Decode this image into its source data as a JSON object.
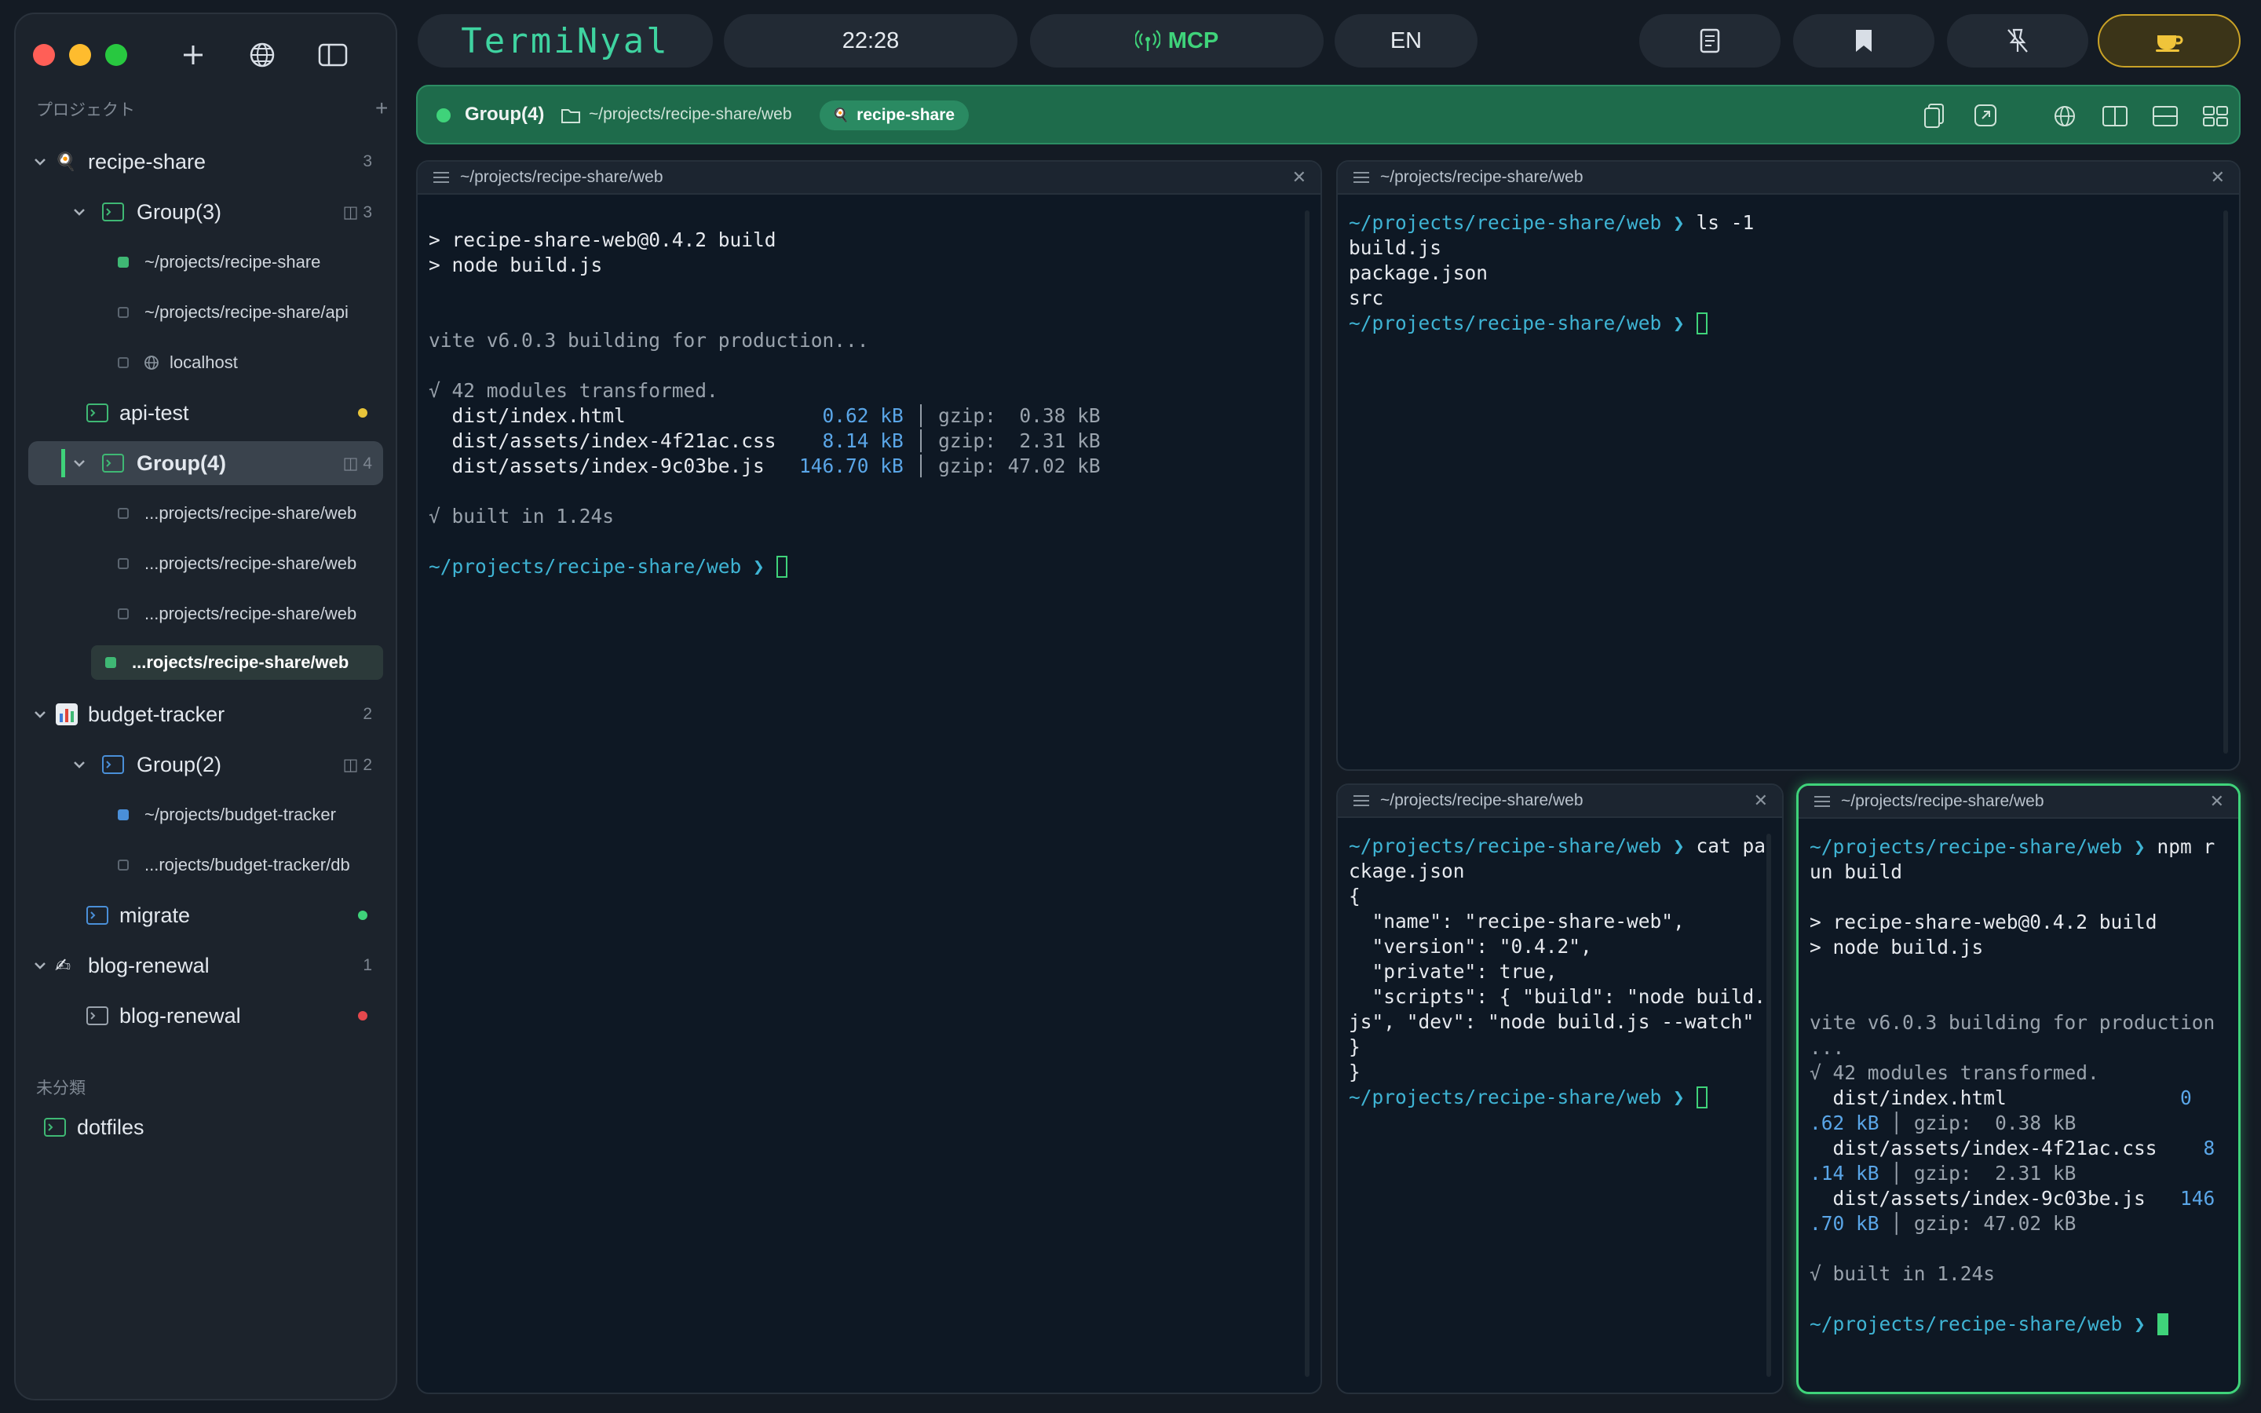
{
  "window": {
    "app_logo_text": "TermiNyal",
    "clock": "22:28",
    "mcp_label": "MCP",
    "lang_label": "EN"
  },
  "sidebar": {
    "projects_heading": "プロジェクト",
    "uncategorized_heading": "未分類",
    "projects": [
      {
        "name": "recipe-share",
        "count": "3",
        "group3": {
          "label": "Group(3)",
          "count": "3",
          "items": [
            "~/projects/recipe-share",
            "~/projects/recipe-share/api",
            "localhost"
          ]
        },
        "api_test": "api-test",
        "group4": {
          "label": "Group(4)",
          "count": "4",
          "items": [
            "...projects/recipe-share/web",
            "...projects/recipe-share/web",
            "...projects/recipe-share/web",
            "...rojects/recipe-share/web"
          ]
        }
      },
      {
        "name": "budget-tracker",
        "count": "2",
        "group2": {
          "label": "Group(2)",
          "count": "2",
          "items": [
            "~/projects/budget-tracker",
            "...rojects/budget-tracker/db"
          ]
        },
        "migrate": "migrate"
      },
      {
        "name": "blog-renewal",
        "count": "1",
        "item": "blog-renewal"
      }
    ],
    "dotfiles": "dotfiles"
  },
  "groupbar": {
    "label": "Group(4)",
    "path": "~/projects/recipe-share/web",
    "project_chip": "recipe-share"
  },
  "panes": {
    "header_path": "~/projects/recipe-share/web",
    "prompt": "~/projects/recipe-share/web ❯",
    "left": {
      "l1": "> recipe-share-web@0.4.2 build",
      "l2": "> node build.js",
      "l3": "vite v6.0.3 building for production...",
      "l4": "√ 42 modules transformed.",
      "f1": "dist/index.html",
      "s1": "0.62 kB",
      "z1": "gzip:  0.38 kB",
      "f2": "dist/assets/index-4f21ac.css",
      "s2": "8.14 kB",
      "z2": "gzip:  2.31 kB",
      "f3": "dist/assets/index-9c03be.js",
      "s3": "146.70 kB",
      "z3": "gzip: 47.02 kB",
      "l5": "√ built in 1.24s"
    },
    "top_right": {
      "cmd": "ls -1",
      "out": [
        "build.js",
        "package.json",
        "src"
      ]
    },
    "bottom_mid": {
      "cmd1": "cat pa",
      "cmd2": "ckage.json",
      "lines": [
        "{",
        "  \"name\": \"recipe-share-web\",",
        "  \"version\": \"0.4.2\",",
        "  \"private\": true,",
        "  \"scripts\": { \"build\": \"node build.",
        "js\", \"dev\": \"node build.js --watch\"",
        "}",
        "}"
      ]
    },
    "bottom_right": {
      "cmd1": "npm r",
      "cmd2": "un build",
      "l1": "> recipe-share-web@0.4.2 build",
      "l2": "> node build.js",
      "l3": "vite v6.0.3 building for production",
      "l3b": "...",
      "l4": "√ 42 modules transformed.",
      "f1": "  dist/index.html",
      "s1a": "0",
      "s1b": ".62 kB",
      "z1": "gzip:  0.38 kB",
      "f2": "  dist/assets/index-4f21ac.css",
      "s2a": "8",
      "s2b": ".14 kB",
      "z2": "gzip:  2.31 kB",
      "f3": "  dist/assets/index-9c03be.js",
      "s3a": "146",
      "s3b": ".70 kB",
      "z3": "gzip: 47.02 kB",
      "l5": "√ built in 1.24s"
    }
  },
  "colors": {
    "accent_green": "#3fd37a",
    "prompt_cyan": "#3fb4d4",
    "group_bar": "#1e6b4b"
  }
}
